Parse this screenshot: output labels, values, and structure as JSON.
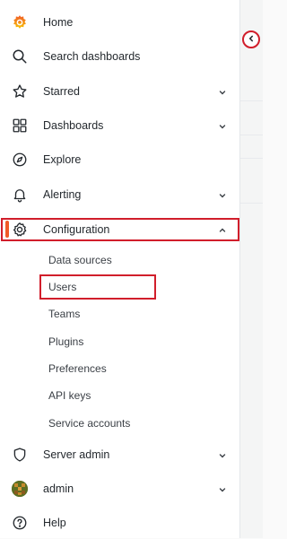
{
  "nav": {
    "home": "Home",
    "search": "Search dashboards",
    "starred": "Starred",
    "dashboards": "Dashboards",
    "explore": "Explore",
    "alerting": "Alerting",
    "configuration": "Configuration",
    "server_admin": "Server admin",
    "admin": "admin",
    "help": "Help"
  },
  "config_submenu": [
    "Data sources",
    "Users",
    "Teams",
    "Plugins",
    "Preferences",
    "API keys",
    "Service accounts"
  ],
  "colors": {
    "accent_orange": "#f05a28",
    "highlight_red": "#d11e2b"
  }
}
